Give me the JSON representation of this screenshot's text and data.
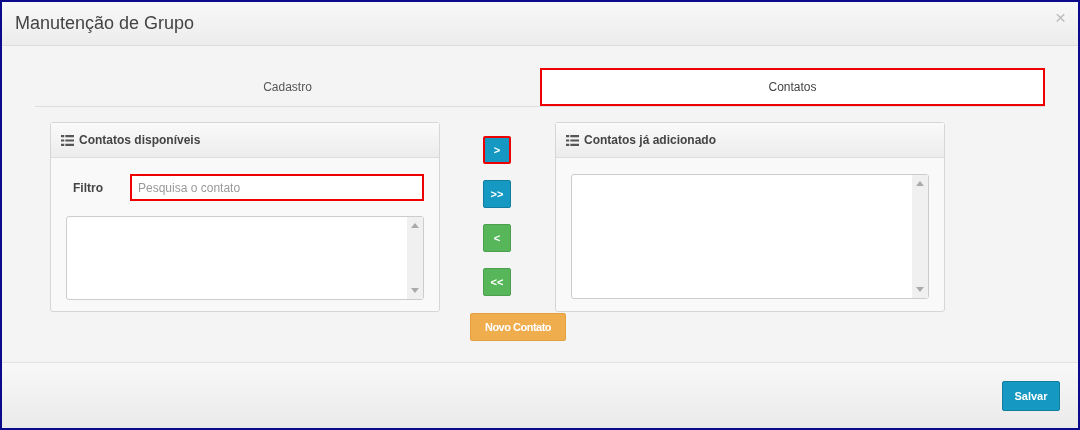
{
  "window": {
    "title": "Manutenção de Grupo",
    "close": "×"
  },
  "tabs": [
    {
      "label": "Cadastro",
      "selected": false,
      "highlighted": false
    },
    {
      "label": "Contatos",
      "selected": true,
      "highlighted": true
    }
  ],
  "available_panel": {
    "title": "Contatos disponíveis",
    "filter_label": "Filtro",
    "filter": {
      "placeholder": "Pesquisa o contato",
      "highlighted": true
    }
  },
  "move_buttons": [
    {
      "label": ">",
      "kind": "primary",
      "highlighted": true
    },
    {
      "label": ">>",
      "kind": "primary",
      "highlighted": false
    },
    {
      "label": "<",
      "kind": "success",
      "highlighted": false
    },
    {
      "label": "<<",
      "kind": "success",
      "highlighted": false
    }
  ],
  "new_contact_button": "Novo Contato",
  "added_panel": {
    "title": "Contatos já adicionado"
  },
  "save_button": "Salvar"
}
